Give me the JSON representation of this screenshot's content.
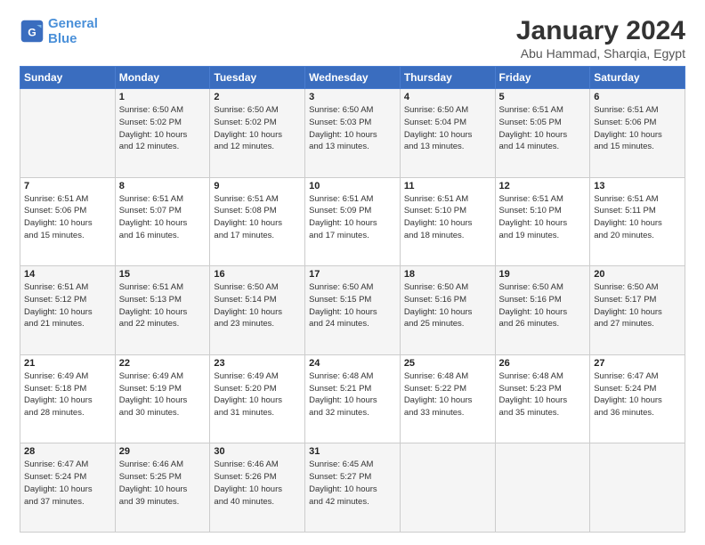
{
  "logo": {
    "line1": "General",
    "line2": "Blue"
  },
  "title": "January 2024",
  "subtitle": "Abu Hammad, Sharqia, Egypt",
  "header": {
    "days": [
      "Sunday",
      "Monday",
      "Tuesday",
      "Wednesday",
      "Thursday",
      "Friday",
      "Saturday"
    ]
  },
  "weeks": [
    [
      {
        "num": "",
        "info": ""
      },
      {
        "num": "1",
        "info": "Sunrise: 6:50 AM\nSunset: 5:02 PM\nDaylight: 10 hours\nand 12 minutes."
      },
      {
        "num": "2",
        "info": "Sunrise: 6:50 AM\nSunset: 5:02 PM\nDaylight: 10 hours\nand 12 minutes."
      },
      {
        "num": "3",
        "info": "Sunrise: 6:50 AM\nSunset: 5:03 PM\nDaylight: 10 hours\nand 13 minutes."
      },
      {
        "num": "4",
        "info": "Sunrise: 6:50 AM\nSunset: 5:04 PM\nDaylight: 10 hours\nand 13 minutes."
      },
      {
        "num": "5",
        "info": "Sunrise: 6:51 AM\nSunset: 5:05 PM\nDaylight: 10 hours\nand 14 minutes."
      },
      {
        "num": "6",
        "info": "Sunrise: 6:51 AM\nSunset: 5:06 PM\nDaylight: 10 hours\nand 15 minutes."
      }
    ],
    [
      {
        "num": "7",
        "info": "Sunrise: 6:51 AM\nSunset: 5:06 PM\nDaylight: 10 hours\nand 15 minutes."
      },
      {
        "num": "8",
        "info": "Sunrise: 6:51 AM\nSunset: 5:07 PM\nDaylight: 10 hours\nand 16 minutes."
      },
      {
        "num": "9",
        "info": "Sunrise: 6:51 AM\nSunset: 5:08 PM\nDaylight: 10 hours\nand 17 minutes."
      },
      {
        "num": "10",
        "info": "Sunrise: 6:51 AM\nSunset: 5:09 PM\nDaylight: 10 hours\nand 17 minutes."
      },
      {
        "num": "11",
        "info": "Sunrise: 6:51 AM\nSunset: 5:10 PM\nDaylight: 10 hours\nand 18 minutes."
      },
      {
        "num": "12",
        "info": "Sunrise: 6:51 AM\nSunset: 5:10 PM\nDaylight: 10 hours\nand 19 minutes."
      },
      {
        "num": "13",
        "info": "Sunrise: 6:51 AM\nSunset: 5:11 PM\nDaylight: 10 hours\nand 20 minutes."
      }
    ],
    [
      {
        "num": "14",
        "info": "Sunrise: 6:51 AM\nSunset: 5:12 PM\nDaylight: 10 hours\nand 21 minutes."
      },
      {
        "num": "15",
        "info": "Sunrise: 6:51 AM\nSunset: 5:13 PM\nDaylight: 10 hours\nand 22 minutes."
      },
      {
        "num": "16",
        "info": "Sunrise: 6:50 AM\nSunset: 5:14 PM\nDaylight: 10 hours\nand 23 minutes."
      },
      {
        "num": "17",
        "info": "Sunrise: 6:50 AM\nSunset: 5:15 PM\nDaylight: 10 hours\nand 24 minutes."
      },
      {
        "num": "18",
        "info": "Sunrise: 6:50 AM\nSunset: 5:16 PM\nDaylight: 10 hours\nand 25 minutes."
      },
      {
        "num": "19",
        "info": "Sunrise: 6:50 AM\nSunset: 5:16 PM\nDaylight: 10 hours\nand 26 minutes."
      },
      {
        "num": "20",
        "info": "Sunrise: 6:50 AM\nSunset: 5:17 PM\nDaylight: 10 hours\nand 27 minutes."
      }
    ],
    [
      {
        "num": "21",
        "info": "Sunrise: 6:49 AM\nSunset: 5:18 PM\nDaylight: 10 hours\nand 28 minutes."
      },
      {
        "num": "22",
        "info": "Sunrise: 6:49 AM\nSunset: 5:19 PM\nDaylight: 10 hours\nand 30 minutes."
      },
      {
        "num": "23",
        "info": "Sunrise: 6:49 AM\nSunset: 5:20 PM\nDaylight: 10 hours\nand 31 minutes."
      },
      {
        "num": "24",
        "info": "Sunrise: 6:48 AM\nSunset: 5:21 PM\nDaylight: 10 hours\nand 32 minutes."
      },
      {
        "num": "25",
        "info": "Sunrise: 6:48 AM\nSunset: 5:22 PM\nDaylight: 10 hours\nand 33 minutes."
      },
      {
        "num": "26",
        "info": "Sunrise: 6:48 AM\nSunset: 5:23 PM\nDaylight: 10 hours\nand 35 minutes."
      },
      {
        "num": "27",
        "info": "Sunrise: 6:47 AM\nSunset: 5:24 PM\nDaylight: 10 hours\nand 36 minutes."
      }
    ],
    [
      {
        "num": "28",
        "info": "Sunrise: 6:47 AM\nSunset: 5:24 PM\nDaylight: 10 hours\nand 37 minutes."
      },
      {
        "num": "29",
        "info": "Sunrise: 6:46 AM\nSunset: 5:25 PM\nDaylight: 10 hours\nand 39 minutes."
      },
      {
        "num": "30",
        "info": "Sunrise: 6:46 AM\nSunset: 5:26 PM\nDaylight: 10 hours\nand 40 minutes."
      },
      {
        "num": "31",
        "info": "Sunrise: 6:45 AM\nSunset: 5:27 PM\nDaylight: 10 hours\nand 42 minutes."
      },
      {
        "num": "",
        "info": ""
      },
      {
        "num": "",
        "info": ""
      },
      {
        "num": "",
        "info": ""
      }
    ]
  ],
  "colors": {
    "header_bg": "#3a6dbf",
    "odd_row": "#f5f5f5",
    "even_row": "#ffffff"
  }
}
